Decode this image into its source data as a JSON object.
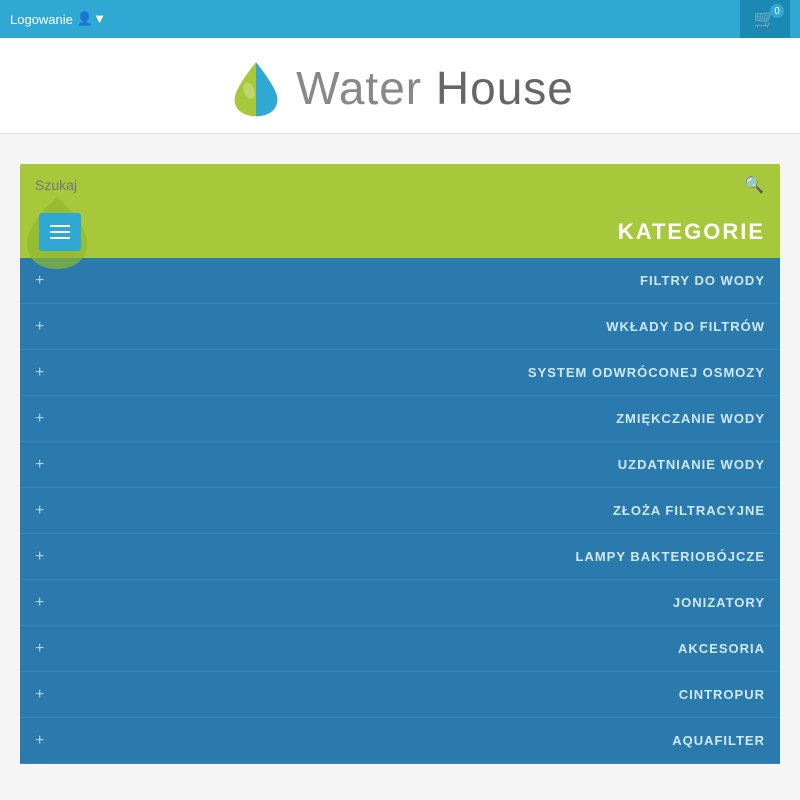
{
  "topbar": {
    "login_label": "Logowanie",
    "cart_count": "0"
  },
  "header": {
    "site_name": "Water House",
    "logo_alt": "Water House Logo"
  },
  "search": {
    "placeholder": "Szukaj"
  },
  "categories": {
    "title": "KATEGORIE",
    "items": [
      {
        "label": "FILTRY DO WODY"
      },
      {
        "label": "WKŁADY DO FILTRÓW"
      },
      {
        "label": "SYSTEM ODWRÓCONEJ OSMOZY"
      },
      {
        "label": "ZMIĘKCZANIE WODY"
      },
      {
        "label": "UZDATNIANIE WODY"
      },
      {
        "label": "ZŁOŻA FILTRACYJNE"
      },
      {
        "label": "LAMPY BAKTERIOBÓJCZE"
      },
      {
        "label": "JONIZATORY"
      },
      {
        "label": "AKCESORIA"
      },
      {
        "label": "CINTROPUR"
      },
      {
        "label": "AQUAFILTER"
      }
    ],
    "expand_icon": "+"
  },
  "colors": {
    "topbar_bg": "#2fa8d4",
    "accent_green": "#a8c83c",
    "category_bg": "#2a7aad"
  }
}
